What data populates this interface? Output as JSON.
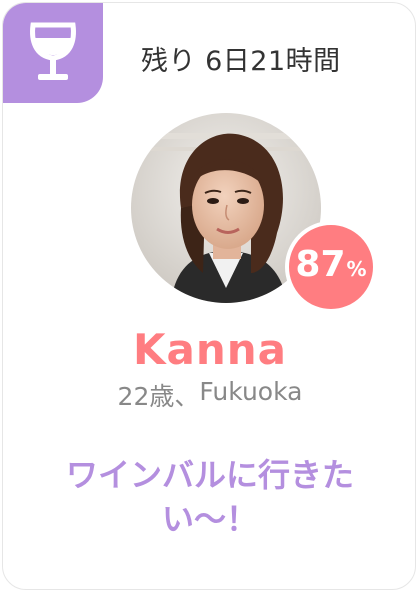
{
  "card": {
    "category_icon": "wine-glass-icon",
    "remaining_label": "残り",
    "remaining_time": "6日21時間",
    "profile": {
      "match_percent": "87",
      "match_unit": "%",
      "name": "Kanna",
      "age": "22歳",
      "separator": "、",
      "location": "Fukuoka",
      "message": "ワインバルに行きたい〜！"
    }
  },
  "colors": {
    "accent_purple": "#b48fdf",
    "accent_pink": "#ff7d81",
    "text_dark": "#333333",
    "text_gray": "#888888"
  }
}
